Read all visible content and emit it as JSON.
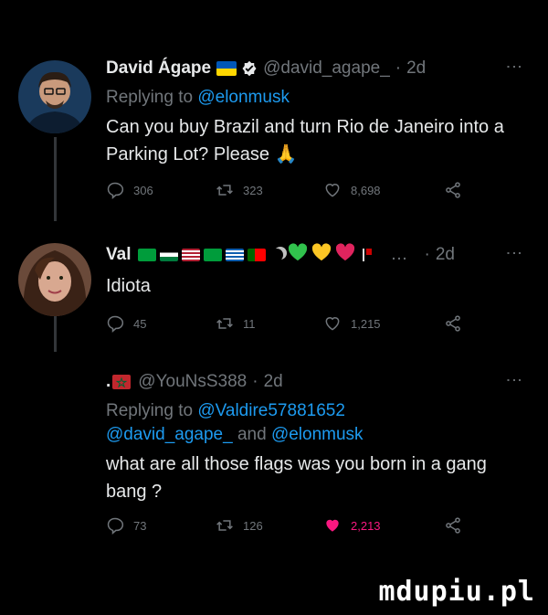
{
  "tweets": [
    {
      "name": "David Ágape",
      "handle": "@david_agape_",
      "separator": "·",
      "time": "2d",
      "replying_prefix": "Replying to ",
      "replying_to": "@elonmusk",
      "body": "Can you buy Brazil and turn Rio de Janeiro into a Parking Lot? Please 🙏",
      "replies": "306",
      "retweets": "323",
      "likes": "8,698"
    },
    {
      "name": "Val",
      "ellipsis": "…",
      "separator": "·",
      "time": "2d",
      "body": "Idiota",
      "replies": "45",
      "retweets": "11",
      "likes": "1,215"
    },
    {
      "name_prefix": ".",
      "handle": "@YouNsS388",
      "separator": "·",
      "time": "2d",
      "replying_prefix": "Replying to ",
      "replying_to": "@Valdire57881652",
      "replying_to_2": "@david_agape_",
      "replying_and": " and ",
      "replying_to_3": "@elonmusk",
      "body": "what are all those flags was you born in a gang bang ?",
      "replies": "73",
      "retweets": "126",
      "likes": "2,213"
    }
  ],
  "watermark": "mdupiu.pl",
  "colors": {
    "accent": "#1d9bf0",
    "like": "#f91880",
    "muted": "#71767b"
  }
}
